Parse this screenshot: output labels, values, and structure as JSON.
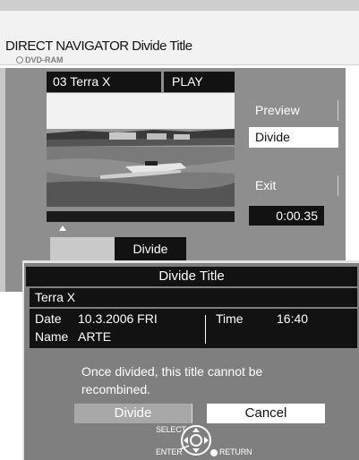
{
  "header": {
    "title": "DIRECT NAVIGATOR  Divide Title",
    "media": "DVD-RAM"
  },
  "preview": {
    "clip_label": "03 Terra X",
    "mode_label": "PLAY"
  },
  "side_menu": {
    "preview": "Preview",
    "divide": "Divide",
    "exit": "Exit",
    "timecode": "0:00.35"
  },
  "tab": {
    "divide_label": "Divide"
  },
  "dialog": {
    "title": "Divide Title",
    "program": "Terra X",
    "date_label": "Date",
    "date_value": "10.3.2006 FRI",
    "time_label": "Time",
    "time_value": "16:40",
    "name_label": "Name",
    "name_value": "ARTE",
    "message": "Once divided, this title cannot be recombined.",
    "divide_button": "Divide",
    "cancel_button": "Cancel"
  },
  "hints": {
    "select": "SELECT",
    "enter": "ENTER",
    "return": "RETURN"
  },
  "icons": {
    "disc": "disc-icon",
    "dpad": "dpad-icon",
    "return": "return-icon",
    "marker": "progress-marker-icon"
  },
  "colors": {
    "panel": "#8e8e8e",
    "dialog": "#7f7f7f",
    "label_bg": "#121212",
    "highlight": "#ffffff"
  }
}
